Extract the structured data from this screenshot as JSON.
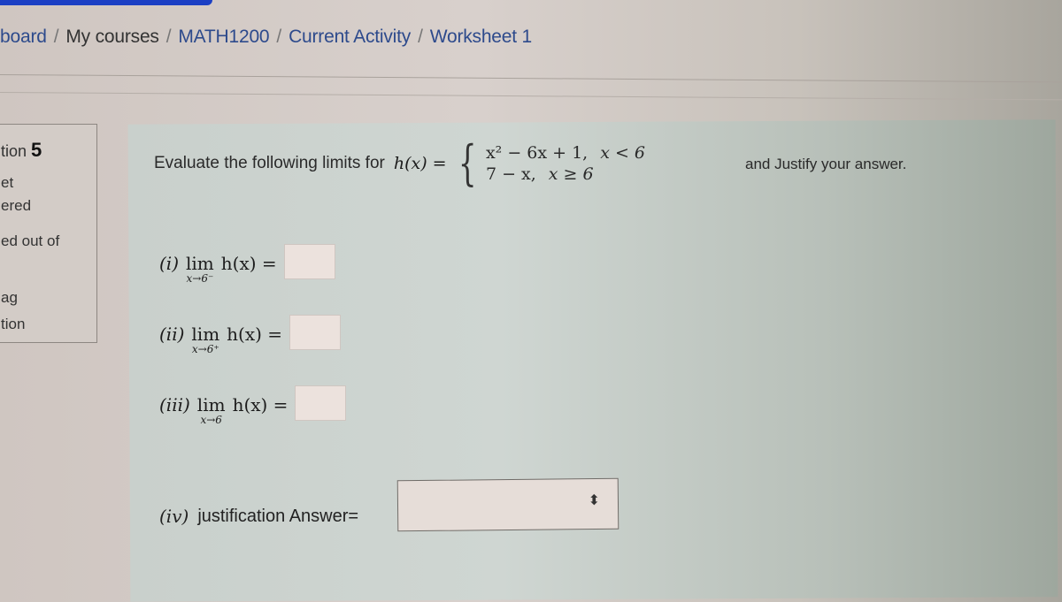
{
  "breadcrumb": {
    "items": [
      {
        "label": "board"
      },
      {
        "label": "My courses"
      },
      {
        "label": "MATH1200"
      },
      {
        "label": "Current Activity"
      },
      {
        "label": "Worksheet 1"
      }
    ],
    "separator": "/"
  },
  "info": {
    "question_label": "tion",
    "question_number": "5",
    "status_line1": "et",
    "status_line2": "ered",
    "marks_line": "ed out of",
    "flag_line1": "ag",
    "flag_line2": "tion"
  },
  "question": {
    "prompt": "Evaluate the following limits for",
    "function_lhs": "h(x) =",
    "case1_expr": "x² − 6x + 1,",
    "case1_cond": "x < 6",
    "case2_expr": "7 − x,",
    "case2_cond": "x ≥ 6",
    "tail": "and Justify your answer."
  },
  "parts": [
    {
      "label": "(i)",
      "lim": "lim",
      "sub": "x→6⁻",
      "expr": "h(x) =",
      "answer": ""
    },
    {
      "label": "(ii)",
      "lim": "lim",
      "sub": "x→6⁺",
      "expr": "h(x) =",
      "answer": ""
    },
    {
      "label": "(iii)",
      "lim": "lim",
      "sub": "x→6",
      "expr": "h(x) =",
      "answer": ""
    }
  ],
  "justification": {
    "label": "(iv)",
    "text": "justification Answer=",
    "selected": "",
    "caret_icon": "⬍"
  }
}
